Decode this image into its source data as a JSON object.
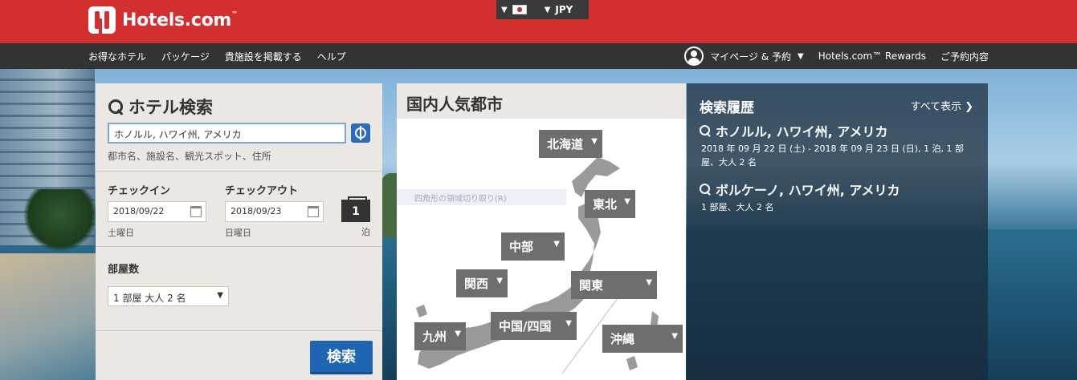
{
  "brand": {
    "name": "Hotels.com",
    "tm": "™"
  },
  "locale": {
    "currency": "JPY",
    "flag_icon": "japan-flag-icon"
  },
  "nav": {
    "left": [
      "お得なホテル",
      "パッケージ",
      "貴施設を掲載する",
      "ヘルプ"
    ],
    "account": "マイページ & 予約",
    "rewards": "Hotels.com™ Rewards",
    "reservations": "ご予約内容"
  },
  "search": {
    "title": "ホテル検索",
    "destination_value": "ホノルル, ハワイ州, アメリカ",
    "destination_hint": "都市名、施設名、観光スポット、住所",
    "checkin_label": "チェックイン",
    "checkin_value": "2018/09/22",
    "checkin_day": "土曜日",
    "checkout_label": "チェックアウト",
    "checkout_value": "2018/09/23",
    "checkout_day": "日曜日",
    "nights_value": "1",
    "nights_label": "泊",
    "rooms_label": "部屋数",
    "rooms_value": "1 部屋 大人 2 名",
    "submit_label": "検索"
  },
  "cities": {
    "title": "国内人気都市",
    "ghost_text": "四角形の領域切り取り(R)",
    "regions": [
      {
        "label": "北海道"
      },
      {
        "label": "東北"
      },
      {
        "label": "中部"
      },
      {
        "label": "関西"
      },
      {
        "label": "関東"
      },
      {
        "label": "中国/四国"
      },
      {
        "label": "九州"
      },
      {
        "label": "沖縄"
      }
    ]
  },
  "history": {
    "title": "検索履歴",
    "view_all": "すべて表示",
    "items": [
      {
        "title": "ホノルル, ハワイ州, アメリカ",
        "detail": "2018 年 09 月 22 日 (土) - 2018 年 09 月 23 日 (日), 1 泊, 1 部屋、大人 2 名"
      },
      {
        "title": "ボルケーノ, ハワイ州, アメリカ",
        "detail": "1 部屋、大人 2 名"
      }
    ]
  },
  "colors": {
    "brand_red": "#d32f2f",
    "nav_dark": "#333333",
    "button_blue": "#1e66b4",
    "region_gray": "#6e6e6e"
  }
}
